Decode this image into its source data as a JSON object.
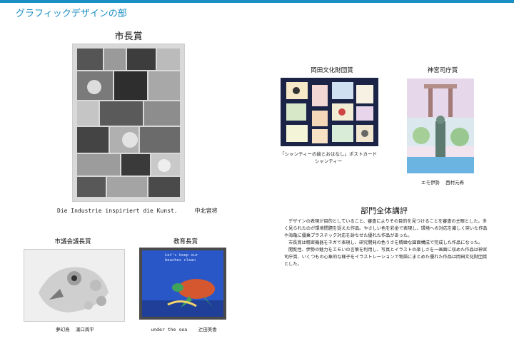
{
  "header": {
    "section_title": "グラフィックデザインの部"
  },
  "awards": {
    "mayor": {
      "title": "市長賞",
      "work": "Die Industrie inspiriert die Kunst.",
      "author": "中北宮将"
    },
    "okada": {
      "title": "岡田文化財団賞",
      "caption_line1": "「シャンティーの絵とおはなし」ポストカード",
      "caption_line2": "シャンティー"
    },
    "jingu": {
      "title": "神宮司庁賞",
      "work": "エモ伊勢",
      "author": "西村元希"
    },
    "council": {
      "title": "市議会議長賞",
      "work": "夢幻鳥",
      "author": "濱口周平"
    },
    "education": {
      "title": "教育長賞",
      "work": "under the sea",
      "author": "辻田美香",
      "poster_text": "Let's keep our beaches clean"
    }
  },
  "review": {
    "title": "部門全体講評",
    "paragraphs": [
      "デザインの表現が目的としていること、審査によりその目的を見つけることを審査の主眼とした。多く見られたのが環境問題を捉えた作品。やさしい色を彩金で表現し、環境への対応を厳しく突いた作品や海亀に優乗プラスチック対応を訴ちせた優れた作品があった。",
      "市長賞は精密機器をネガで表現し、研究開発の色うさを精緻な図面構成で完成した作品になった。",
      "閲覧性、伊勢の魅力をエモいの言葉を利用し、写真とイラストの楽しさを一画面に収めた作品は神宮司庁賞、いくつもの心象的な様子をイラストレーションで物語にまとめた優れた作品は岡田文化財団賞とした。"
    ]
  },
  "colors": {
    "accent": "#1a8fc4",
    "navy": "#1b2347",
    "sea": "#2a57c8"
  }
}
